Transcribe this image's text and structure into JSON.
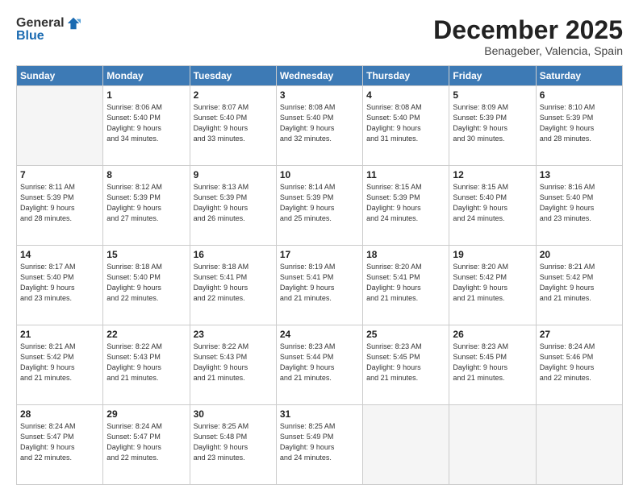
{
  "header": {
    "logo_general": "General",
    "logo_blue": "Blue",
    "month": "December 2025",
    "location": "Benageber, Valencia, Spain"
  },
  "days_of_week": [
    "Sunday",
    "Monday",
    "Tuesday",
    "Wednesday",
    "Thursday",
    "Friday",
    "Saturday"
  ],
  "weeks": [
    [
      {
        "day": "",
        "info": ""
      },
      {
        "day": "1",
        "info": "Sunrise: 8:06 AM\nSunset: 5:40 PM\nDaylight: 9 hours\nand 34 minutes."
      },
      {
        "day": "2",
        "info": "Sunrise: 8:07 AM\nSunset: 5:40 PM\nDaylight: 9 hours\nand 33 minutes."
      },
      {
        "day": "3",
        "info": "Sunrise: 8:08 AM\nSunset: 5:40 PM\nDaylight: 9 hours\nand 32 minutes."
      },
      {
        "day": "4",
        "info": "Sunrise: 8:08 AM\nSunset: 5:40 PM\nDaylight: 9 hours\nand 31 minutes."
      },
      {
        "day": "5",
        "info": "Sunrise: 8:09 AM\nSunset: 5:39 PM\nDaylight: 9 hours\nand 30 minutes."
      },
      {
        "day": "6",
        "info": "Sunrise: 8:10 AM\nSunset: 5:39 PM\nDaylight: 9 hours\nand 28 minutes."
      }
    ],
    [
      {
        "day": "7",
        "info": "Sunrise: 8:11 AM\nSunset: 5:39 PM\nDaylight: 9 hours\nand 28 minutes."
      },
      {
        "day": "8",
        "info": "Sunrise: 8:12 AM\nSunset: 5:39 PM\nDaylight: 9 hours\nand 27 minutes."
      },
      {
        "day": "9",
        "info": "Sunrise: 8:13 AM\nSunset: 5:39 PM\nDaylight: 9 hours\nand 26 minutes."
      },
      {
        "day": "10",
        "info": "Sunrise: 8:14 AM\nSunset: 5:39 PM\nDaylight: 9 hours\nand 25 minutes."
      },
      {
        "day": "11",
        "info": "Sunrise: 8:15 AM\nSunset: 5:39 PM\nDaylight: 9 hours\nand 24 minutes."
      },
      {
        "day": "12",
        "info": "Sunrise: 8:15 AM\nSunset: 5:40 PM\nDaylight: 9 hours\nand 24 minutes."
      },
      {
        "day": "13",
        "info": "Sunrise: 8:16 AM\nSunset: 5:40 PM\nDaylight: 9 hours\nand 23 minutes."
      }
    ],
    [
      {
        "day": "14",
        "info": "Sunrise: 8:17 AM\nSunset: 5:40 PM\nDaylight: 9 hours\nand 23 minutes."
      },
      {
        "day": "15",
        "info": "Sunrise: 8:18 AM\nSunset: 5:40 PM\nDaylight: 9 hours\nand 22 minutes."
      },
      {
        "day": "16",
        "info": "Sunrise: 8:18 AM\nSunset: 5:41 PM\nDaylight: 9 hours\nand 22 minutes."
      },
      {
        "day": "17",
        "info": "Sunrise: 8:19 AM\nSunset: 5:41 PM\nDaylight: 9 hours\nand 21 minutes."
      },
      {
        "day": "18",
        "info": "Sunrise: 8:20 AM\nSunset: 5:41 PM\nDaylight: 9 hours\nand 21 minutes."
      },
      {
        "day": "19",
        "info": "Sunrise: 8:20 AM\nSunset: 5:42 PM\nDaylight: 9 hours\nand 21 minutes."
      },
      {
        "day": "20",
        "info": "Sunrise: 8:21 AM\nSunset: 5:42 PM\nDaylight: 9 hours\nand 21 minutes."
      }
    ],
    [
      {
        "day": "21",
        "info": "Sunrise: 8:21 AM\nSunset: 5:42 PM\nDaylight: 9 hours\nand 21 minutes."
      },
      {
        "day": "22",
        "info": "Sunrise: 8:22 AM\nSunset: 5:43 PM\nDaylight: 9 hours\nand 21 minutes."
      },
      {
        "day": "23",
        "info": "Sunrise: 8:22 AM\nSunset: 5:43 PM\nDaylight: 9 hours\nand 21 minutes."
      },
      {
        "day": "24",
        "info": "Sunrise: 8:23 AM\nSunset: 5:44 PM\nDaylight: 9 hours\nand 21 minutes."
      },
      {
        "day": "25",
        "info": "Sunrise: 8:23 AM\nSunset: 5:45 PM\nDaylight: 9 hours\nand 21 minutes."
      },
      {
        "day": "26",
        "info": "Sunrise: 8:23 AM\nSunset: 5:45 PM\nDaylight: 9 hours\nand 21 minutes."
      },
      {
        "day": "27",
        "info": "Sunrise: 8:24 AM\nSunset: 5:46 PM\nDaylight: 9 hours\nand 22 minutes."
      }
    ],
    [
      {
        "day": "28",
        "info": "Sunrise: 8:24 AM\nSunset: 5:47 PM\nDaylight: 9 hours\nand 22 minutes."
      },
      {
        "day": "29",
        "info": "Sunrise: 8:24 AM\nSunset: 5:47 PM\nDaylight: 9 hours\nand 22 minutes."
      },
      {
        "day": "30",
        "info": "Sunrise: 8:25 AM\nSunset: 5:48 PM\nDaylight: 9 hours\nand 23 minutes."
      },
      {
        "day": "31",
        "info": "Sunrise: 8:25 AM\nSunset: 5:49 PM\nDaylight: 9 hours\nand 24 minutes."
      },
      {
        "day": "",
        "info": ""
      },
      {
        "day": "",
        "info": ""
      },
      {
        "day": "",
        "info": ""
      }
    ]
  ]
}
